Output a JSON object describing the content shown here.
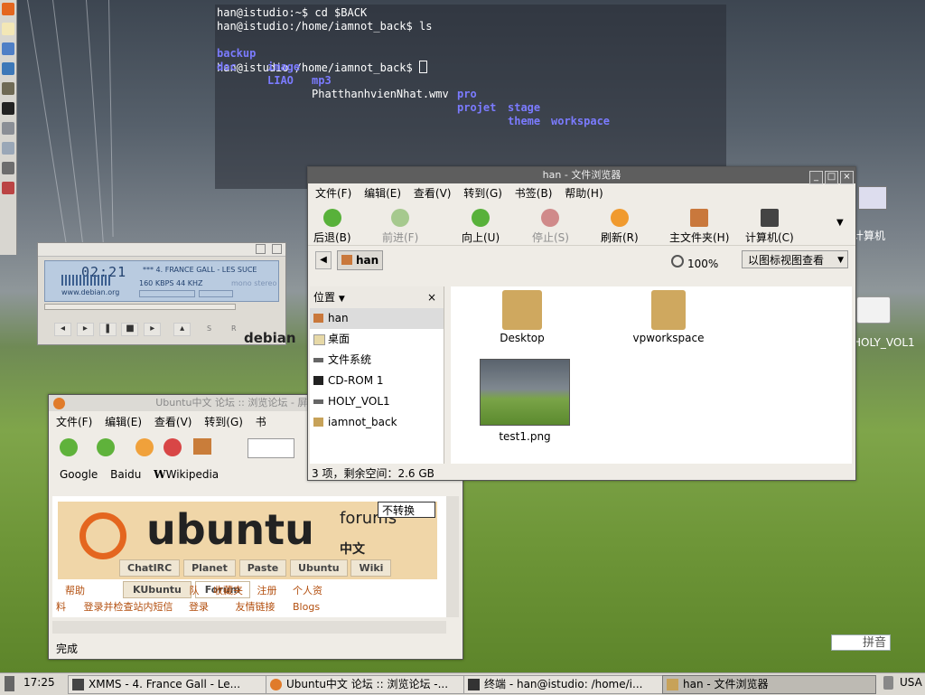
{
  "terminal": {
    "lines": [
      "han@istudio:~$ cd $BACK",
      "han@istudio:/home/iamnot_back$ ls"
    ],
    "ls_row1": [
      "backup",
      "image",
      "mp3",
      "",
      "pro",
      "stage",
      "workspace"
    ],
    "ls_row2": [
      "doc",
      "LIAO",
      "PhatthanhvienNhat.wmv",
      "",
      "projet",
      "theme"
    ],
    "prompt": "han@istudio:/home/iamnot_back$ "
  },
  "xmms": {
    "time": "02:21",
    "song": "*** 4. FRANCE GALL - LES SUCE",
    "kbps": "160",
    "kbps_unit": "KBPS",
    "khz": "44",
    "khz_unit": "KHZ",
    "mono": "mono",
    "stereo": "stereo",
    "site": "www.debian.org",
    "brand": "debian",
    "mini_a": "A",
    "mini_s": "S",
    "mini_r": "R"
  },
  "filebrowser": {
    "title": "han - 文件浏览器",
    "menu": [
      "文件(F)",
      "编辑(E)",
      "查看(V)",
      "转到(G)",
      "书签(B)",
      "帮助(H)"
    ],
    "toolbar": [
      {
        "label": "后退(B)",
        "enabled": true
      },
      {
        "label": "前进(F)",
        "enabled": false
      },
      {
        "label": "向上(U)",
        "enabled": true
      },
      {
        "label": "停止(S)",
        "enabled": false
      },
      {
        "label": "刷新(R)",
        "enabled": true
      },
      {
        "label": "主文件夹(H)",
        "enabled": true
      },
      {
        "label": "计算机(C)",
        "enabled": true
      }
    ],
    "path_button": "han",
    "zoom": "100%",
    "view_mode": "以图标视图查看",
    "sidebar_title": "位置",
    "sidebar_close": "×",
    "places": [
      "han",
      "桌面",
      "文件系统",
      "CD-ROM 1",
      "HOLY_VOL1",
      "iamnot_back"
    ],
    "files": [
      "Desktop",
      "vpworkspace",
      "test1.png"
    ],
    "status": "3 项，剩余空间：2.6 GB"
  },
  "firefox": {
    "title": "Ubuntu中文 论坛 :: 浏览论坛 - 屏幕抓图 - M",
    "menu": [
      "文件(F)",
      "编辑(E)",
      "查看(V)",
      "转到(G)",
      "书"
    ],
    "bookmarks": [
      "Google",
      "Baidu",
      "Wikipedia"
    ],
    "bookmark_w": "W",
    "convert_select": "不转换",
    "logo_word": "ubuntu",
    "logo_forums": "forums",
    "logo_cn": "中文",
    "nav_top": [
      "ChatIRC",
      "Planet",
      "Paste",
      "Ubuntu",
      "Wiki"
    ],
    "nav_bottom": [
      "KUbuntu",
      "Forum"
    ],
    "links_row1": [
      "帮助",
      "队",
      "收藏夹",
      "注册",
      "个人资"
    ],
    "links_row2": [
      "料",
      "登录并检查站内短信",
      "登录",
      "友情链接",
      "Blogs"
    ],
    "status": "完成"
  },
  "desktop": {
    "icons": [
      "计算机",
      "HOLY_VOL1"
    ]
  },
  "taskbar": {
    "clock": "17:25",
    "tasks": [
      "XMMS - 4. France Gall - Le...",
      "Ubuntu中文 论坛 :: 浏览论坛 -...",
      "终端 - han@istudio: /home/i...",
      "han - 文件浏览器"
    ],
    "keyboard": "USA",
    "ime": "拼音"
  },
  "colors": {
    "title_active": "#5e5e5e",
    "terminal_dir": "#7b7bff",
    "ubuntu_orange": "#e4661f",
    "xmms_display": "#b9cbe0"
  }
}
